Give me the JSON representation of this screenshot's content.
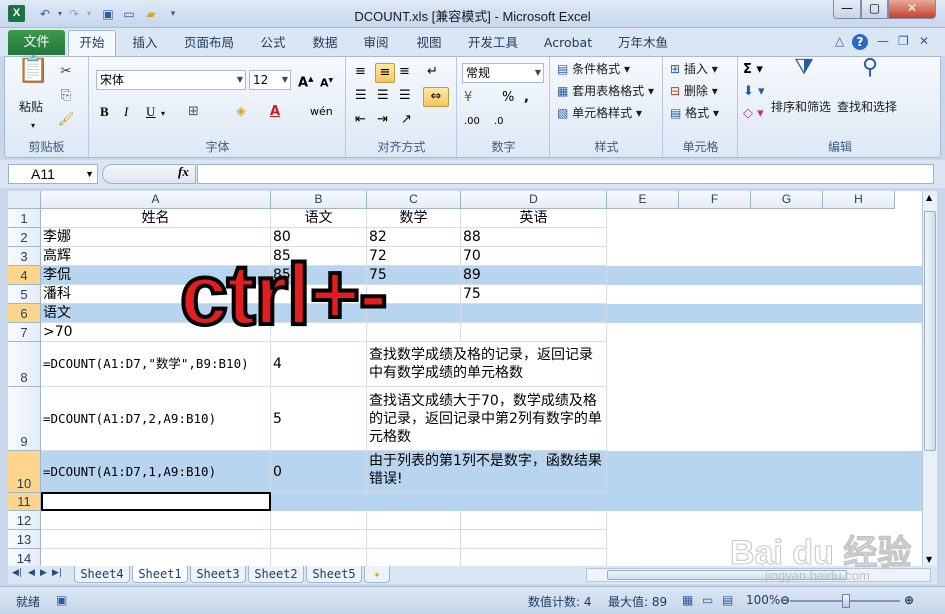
{
  "window": {
    "title": "DCOUNT.xls  [兼容模式] - Microsoft Excel",
    "app_icon": "X"
  },
  "tabs": [
    "文件",
    "开始",
    "插入",
    "页面布局",
    "公式",
    "数据",
    "审阅",
    "视图",
    "开发工具",
    "Acrobat",
    "万年木鱼"
  ],
  "ribbon": {
    "clipboard": {
      "label": "剪贴板",
      "paste": "粘贴"
    },
    "font": {
      "label": "字体",
      "font_name": "宋体",
      "font_size": "12"
    },
    "alignment": {
      "label": "对齐方式"
    },
    "number": {
      "label": "数字",
      "format": "常规"
    },
    "styles": {
      "label": "样式",
      "conditional": "条件格式",
      "table": "套用表格格式",
      "cell_styles": "单元格样式"
    },
    "cells": {
      "label": "单元格",
      "insert": "插入",
      "delete": "删除",
      "format": "格式"
    },
    "editing": {
      "label": "编辑",
      "sort_filter": "排序和筛选",
      "find_select": "查找和选择"
    }
  },
  "formula_bar": {
    "name_box": "A11",
    "fx": "fx",
    "formula": ""
  },
  "columns": [
    "A",
    "B",
    "C",
    "D",
    "E",
    "F",
    "G",
    "H"
  ],
  "rows": [
    {
      "num": "1",
      "cells": [
        "姓名",
        "语文",
        "数学",
        "英语"
      ]
    },
    {
      "num": "2",
      "cells": [
        "李娜",
        "80",
        "82",
        "88"
      ]
    },
    {
      "num": "3",
      "cells": [
        "高辉",
        "85",
        "72",
        "70"
      ]
    },
    {
      "num": "4",
      "cells": [
        "李侃",
        "85",
        "75",
        "89"
      ]
    },
    {
      "num": "5",
      "cells": [
        "潘科",
        "",
        "",
        "75"
      ]
    },
    {
      "num": "6",
      "cells": [
        "语文",
        "",
        "",
        ""
      ]
    },
    {
      "num": "7",
      "cells": [
        ">70",
        "",
        "",
        ""
      ]
    },
    {
      "num": "8",
      "cells": [
        "=DCOUNT(A1:D7,\"数学\",B9:B10)",
        "4",
        "查找数学成绩及格的记录，返回记录中有数学成绩的单元格数",
        ""
      ]
    },
    {
      "num": "9",
      "cells": [
        "=DCOUNT(A1:D7,2,A9:B10)",
        "5",
        "查找语文成绩大于70，数学成绩及格的记录，返回记录中第2列有数字的单元格数",
        ""
      ]
    },
    {
      "num": "10",
      "cells": [
        "=DCOUNT(A1:D7,1,A9:B10)",
        "0",
        "由于列表的第1列不是数字，函数结果错误!",
        ""
      ]
    },
    {
      "num": "11",
      "cells": [
        "",
        "",
        "",
        ""
      ]
    },
    {
      "num": "12",
      "cells": [
        "",
        "",
        "",
        ""
      ]
    },
    {
      "num": "13",
      "cells": [
        "",
        "",
        "",
        ""
      ]
    },
    {
      "num": "14",
      "cells": [
        "",
        "",
        "",
        ""
      ]
    }
  ],
  "overlay_text": "ctrl+-",
  "sheet_tabs": [
    "Sheet4",
    "Sheet1",
    "Sheet3",
    "Sheet2",
    "Sheet5"
  ],
  "active_sheet": "Sheet1",
  "status": {
    "ready": "就绪",
    "count": "数值计数: 4",
    "max": "最大值: 89",
    "zoom": "100%"
  },
  "watermark": {
    "main": "Bai du 经验",
    "sub": "jingyan.baidu.com"
  }
}
